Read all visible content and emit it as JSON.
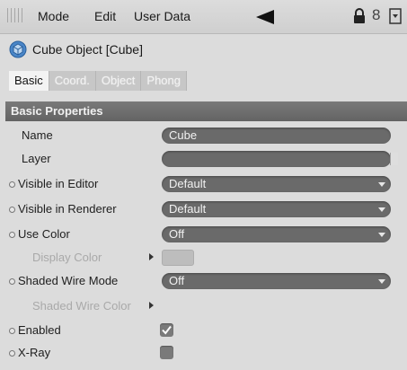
{
  "menubar": {
    "items": [
      "Mode",
      "Edit",
      "User Data"
    ],
    "number_icon": "8"
  },
  "object": {
    "title": "Cube Object [Cube]"
  },
  "tabs": [
    "Basic",
    "Coord.",
    "Object",
    "Phong"
  ],
  "active_tab": "Basic",
  "section": {
    "title": "Basic Properties"
  },
  "properties": {
    "name": {
      "label": "Name",
      "value": "Cube"
    },
    "layer": {
      "label": "Layer",
      "value": ""
    },
    "visible_editor": {
      "label": "Visible in Editor",
      "value": "Default"
    },
    "visible_renderer": {
      "label": "Visible in Renderer",
      "value": "Default"
    },
    "use_color": {
      "label": "Use Color",
      "value": "Off"
    },
    "display_color": {
      "label": "Display Color"
    },
    "shaded_wire_mode": {
      "label": "Shaded Wire Mode",
      "value": "Off"
    },
    "shaded_wire_color": {
      "label": "Shaded Wire Color"
    },
    "enabled": {
      "label": "Enabled",
      "checked": true
    },
    "xray": {
      "label": "X-Ray",
      "checked": false
    }
  },
  "colors": {
    "field_bg": "#6a6a6a",
    "section_bg": "#6b6b6b",
    "panel_bg": "#dcdcdc"
  }
}
